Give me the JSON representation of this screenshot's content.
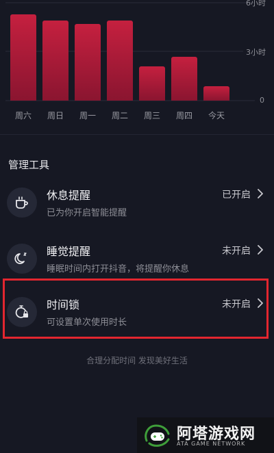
{
  "chart_data": {
    "type": "bar",
    "categories": [
      "周六",
      "周日",
      "周一",
      "周二",
      "周三",
      "周四",
      "今天"
    ],
    "values": [
      5.3,
      4.9,
      4.7,
      4.9,
      2.1,
      2.7,
      0.9
    ],
    "yticks": [
      "6小时",
      "3小时",
      "0"
    ],
    "ylim": [
      0,
      6
    ],
    "colors": {
      "bar_top": "#c5203f",
      "bar_bottom": "#8a1530"
    }
  },
  "tools": {
    "section_title": "管理工具",
    "items": [
      {
        "title": "休息提醒",
        "desc": "已为你开启智能提醒",
        "status": "已开启",
        "icon": "coffee-cup-icon"
      },
      {
        "title": "睡觉提醒",
        "desc": "睡眠时间内打开抖音，将提醒你休息",
        "status": "未开启",
        "icon": "moon-sleep-icon"
      },
      {
        "title": "时间锁",
        "desc": "可设置单次使用时长",
        "status": "未开启",
        "icon": "timer-lock-icon"
      }
    ]
  },
  "footer": {
    "text": "合理分配时间 发现美好生活"
  },
  "watermark": {
    "title": "阿塔游戏网",
    "subtitle": "ATA GAME NETWORK"
  },
  "colors": {
    "background": "#161823",
    "highlight": "#e3262f"
  }
}
